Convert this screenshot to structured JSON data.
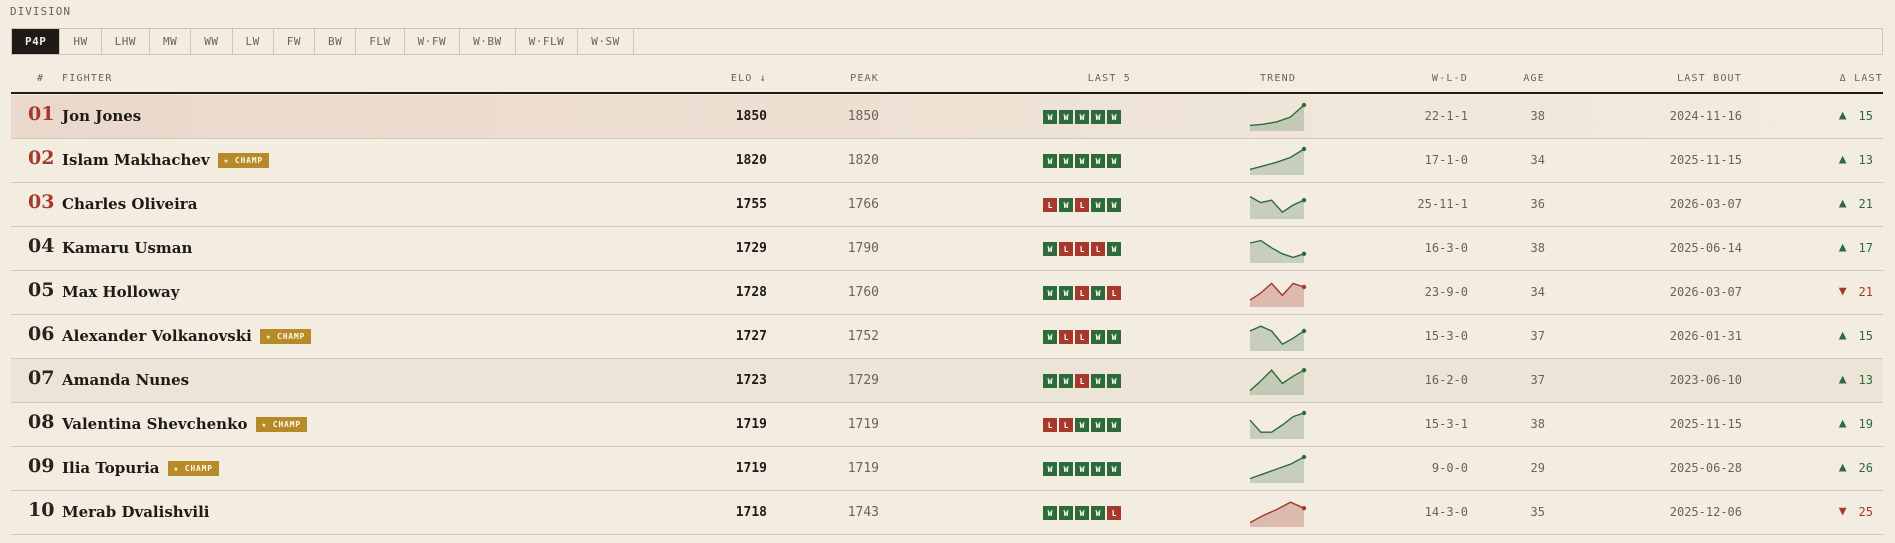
{
  "division": {
    "label": "DIVISION",
    "tabs": [
      "P4P",
      "HW",
      "LHW",
      "MW",
      "WW",
      "LW",
      "FW",
      "BW",
      "FLW",
      "W·FW",
      "W·BW",
      "W·FLW",
      "W·SW"
    ],
    "active": "P4P"
  },
  "columns": {
    "rank": "#",
    "fighter": "FIGHTER",
    "elo": "ELO",
    "elo_sort": "↓",
    "peak": "PEAK",
    "last5": "LAST 5",
    "trend": "TREND",
    "wld": "W-L-D",
    "age": "AGE",
    "last_bout": "LAST BOUT",
    "delta": "Δ LAST"
  },
  "champ_badge": "★ CHAMP",
  "colors": {
    "win": "#2f6b3a",
    "loss": "#a6392b",
    "champ": "#b68a28",
    "accent_red": "#a6392b"
  },
  "fighters": [
    {
      "rank": "01",
      "name": "Jon Jones",
      "champ": false,
      "elo": "1850",
      "peak": "1850",
      "last5": [
        "W",
        "W",
        "W",
        "W",
        "W"
      ],
      "trend": [
        0.15,
        0.2,
        0.3,
        0.5,
        1.0
      ],
      "trend_dir": "up",
      "wld": "22-1-1",
      "age": "38",
      "last_bout": "2024-11-16",
      "delta_dir": "up",
      "delta": "15"
    },
    {
      "rank": "02",
      "name": "Islam Makhachev",
      "champ": true,
      "elo": "1820",
      "peak": "1820",
      "last5": [
        "W",
        "W",
        "W",
        "W",
        "W"
      ],
      "trend": [
        0.15,
        0.3,
        0.45,
        0.65,
        1.0
      ],
      "trend_dir": "up",
      "wld": "17-1-0",
      "age": "34",
      "last_bout": "2025-11-15",
      "delta_dir": "up",
      "delta": "13"
    },
    {
      "rank": "03",
      "name": "Charles Oliveira",
      "champ": false,
      "elo": "1755",
      "peak": "1766",
      "last5": [
        "L",
        "W",
        "L",
        "W",
        "W"
      ],
      "trend": [
        0.85,
        0.6,
        0.7,
        0.2,
        0.5,
        0.7
      ],
      "trend_dir": "up",
      "wld": "25-11-1",
      "age": "36",
      "last_bout": "2026-03-07",
      "delta_dir": "up",
      "delta": "21"
    },
    {
      "rank": "04",
      "name": "Kamaru Usman",
      "champ": false,
      "elo": "1729",
      "peak": "1790",
      "last5": [
        "W",
        "L",
        "L",
        "L",
        "W"
      ],
      "trend": [
        0.75,
        0.85,
        0.55,
        0.3,
        0.15,
        0.3
      ],
      "trend_dir": "up",
      "wld": "16-3-0",
      "age": "38",
      "last_bout": "2025-06-14",
      "delta_dir": "up",
      "delta": "17"
    },
    {
      "rank": "05",
      "name": "Max Holloway",
      "champ": false,
      "elo": "1728",
      "peak": "1760",
      "last5": [
        "W",
        "W",
        "L",
        "W",
        "L"
      ],
      "trend": [
        0.2,
        0.5,
        0.9,
        0.4,
        0.9,
        0.75
      ],
      "trend_dir": "down",
      "wld": "23-9-0",
      "age": "34",
      "last_bout": "2026-03-07",
      "delta_dir": "down",
      "delta": "21"
    },
    {
      "rank": "06",
      "name": "Alexander Volkanovski",
      "champ": true,
      "elo": "1727",
      "peak": "1752",
      "last5": [
        "W",
        "L",
        "L",
        "W",
        "W"
      ],
      "trend": [
        0.75,
        0.95,
        0.75,
        0.2,
        0.45,
        0.75
      ],
      "trend_dir": "up",
      "wld": "15-3-0",
      "age": "37",
      "last_bout": "2026-01-31",
      "delta_dir": "up",
      "delta": "15"
    },
    {
      "rank": "07",
      "name": "Amanda Nunes",
      "champ": false,
      "elo": "1723",
      "peak": "1729",
      "last5": [
        "W",
        "W",
        "L",
        "W",
        "W"
      ],
      "trend": [
        0.1,
        0.5,
        0.95,
        0.4,
        0.7,
        0.95
      ],
      "trend_dir": "up",
      "wld": "16-2-0",
      "age": "37",
      "last_bout": "2023-06-10",
      "delta_dir": "up",
      "delta": "13"
    },
    {
      "rank": "08",
      "name": "Valentina Shevchenko",
      "champ": true,
      "elo": "1719",
      "peak": "1719",
      "last5": [
        "L",
        "L",
        "W",
        "W",
        "W"
      ],
      "trend": [
        0.7,
        0.2,
        0.2,
        0.5,
        0.85,
        1.0
      ],
      "trend_dir": "up",
      "wld": "15-3-1",
      "age": "38",
      "last_bout": "2025-11-15",
      "delta_dir": "up",
      "delta": "19"
    },
    {
      "rank": "09",
      "name": "Ilia Topuria",
      "champ": true,
      "elo": "1719",
      "peak": "1719",
      "last5": [
        "W",
        "W",
        "W",
        "W",
        "W"
      ],
      "trend": [
        0.1,
        0.3,
        0.5,
        0.7,
        1.0
      ],
      "trend_dir": "up",
      "wld": "9-0-0",
      "age": "29",
      "last_bout": "2025-06-28",
      "delta_dir": "up",
      "delta": "26"
    },
    {
      "rank": "10",
      "name": "Merab Dvalishvili",
      "champ": false,
      "elo": "1718",
      "peak": "1743",
      "last5": [
        "W",
        "W",
        "W",
        "W",
        "L"
      ],
      "trend": [
        0.1,
        0.4,
        0.65,
        0.95,
        0.7
      ],
      "trend_dir": "down",
      "wld": "14-3-0",
      "age": "35",
      "last_bout": "2025-12-06",
      "delta_dir": "down",
      "delta": "25"
    }
  ]
}
